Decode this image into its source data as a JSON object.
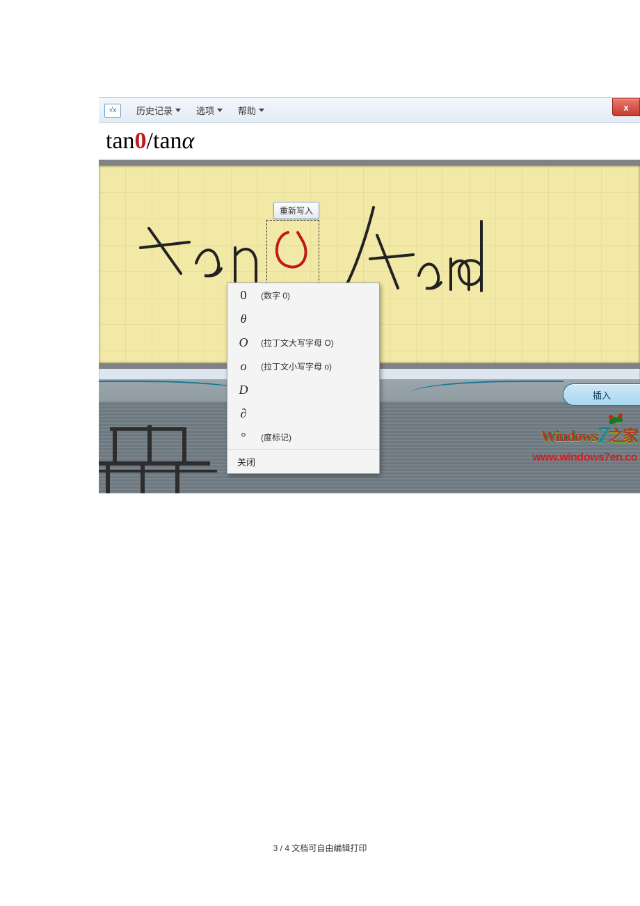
{
  "toolbar": {
    "history": "历史记录",
    "options": "选项",
    "help": "帮助"
  },
  "close_label": "x",
  "formula": {
    "tan1": "tan ",
    "zero": "0",
    "sep": " / ",
    "tan2": "tan ",
    "alpha": "α"
  },
  "rewrite_label": "重新写入",
  "context_menu": {
    "items": [
      {
        "sym": "0",
        "desc": "(数字 0)",
        "upright": true
      },
      {
        "sym": "θ",
        "desc": ""
      },
      {
        "sym": "O",
        "desc": "(拉丁文大写字母 O)"
      },
      {
        "sym": "o",
        "desc": "(拉丁文小写字母 o)"
      },
      {
        "sym": "D",
        "desc": ""
      },
      {
        "sym": "∂",
        "desc": ""
      },
      {
        "sym": "°",
        "desc": "(度标记)",
        "upright": true
      }
    ],
    "close": "关闭"
  },
  "insert_label": "插入",
  "watermark": {
    "line1_a": "Windows",
    "line1_seven": "7",
    "line1_b": "之家",
    "line2": "www.windows7en.co"
  },
  "footer": {
    "page_current": "3",
    "page_sep": " / ",
    "page_total": "4",
    "note": " 文档可自由编辑打印"
  }
}
